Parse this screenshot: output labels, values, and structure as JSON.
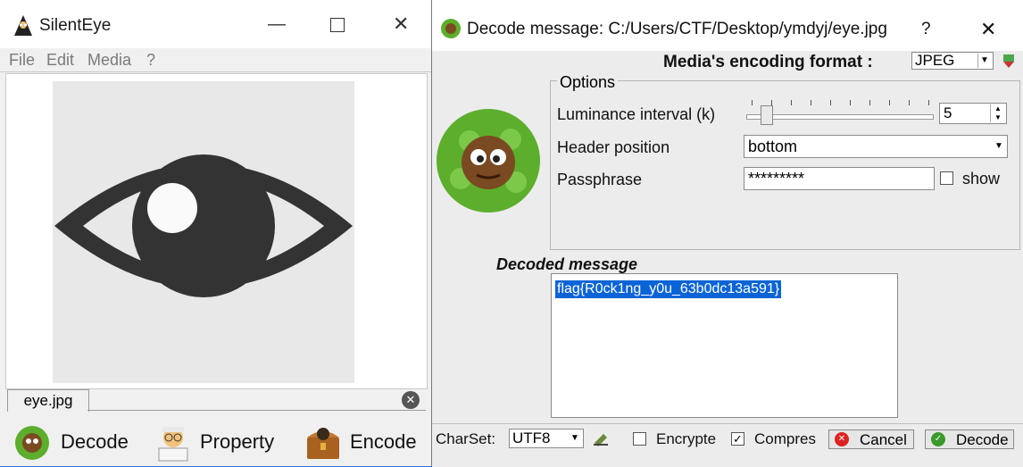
{
  "main": {
    "title": "SilentEye",
    "menu": [
      "File",
      "Edit",
      "Media",
      "?"
    ],
    "tab_label": "eye.jpg",
    "buttons": {
      "decode": "Decode",
      "property": "Property",
      "encode": "Encode"
    }
  },
  "dialog": {
    "title": "Decode message: C:/Users/CTF/Desktop/ymdyj/eye.jpg",
    "help": "?",
    "encoding_label": "Media's encoding format :",
    "encoding_value": "JPEG",
    "options_legend": "Options",
    "luminance_label": "Luminance interval (k)",
    "luminance_value": "5",
    "header_label": "Header position",
    "header_value": "bottom",
    "passphrase_label": "Passphrase",
    "passphrase_value": "*********",
    "show_label": "show",
    "decoded_label": "Decoded message",
    "decoded_text": "flag{R0ck1ng_y0u_63b0dc13a591}",
    "charset_label": "CharSet:",
    "charset_value": "UTF8",
    "encrypted_label": "Encrypte",
    "compressed_label": "Compres",
    "cancel_label": "Cancel",
    "decode_label": "Decode",
    "slider_level": 0.05
  },
  "colors": {
    "selection": "#0a64d6",
    "icon_dark": "#333333",
    "leaf": "#5cae2c"
  }
}
